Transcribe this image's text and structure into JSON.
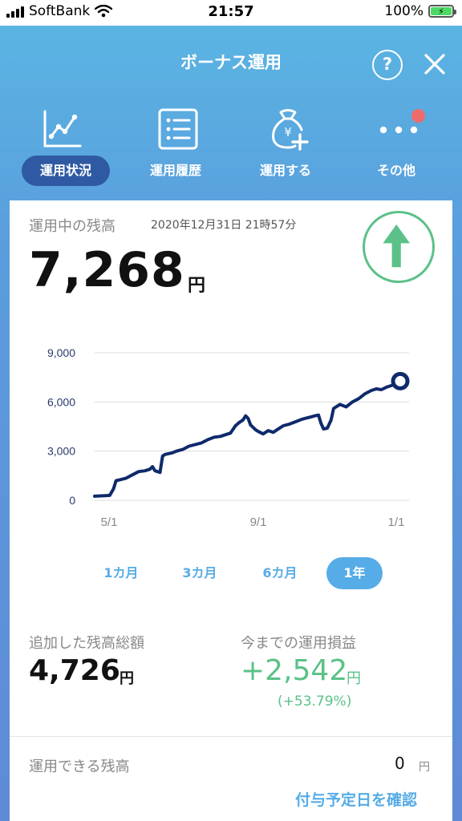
{
  "status_bar": {
    "carrier": "SoftBank",
    "time": "21:57",
    "battery_pct": "100%"
  },
  "header": {
    "title": "ボーナス運用",
    "help_label": "?"
  },
  "nav": {
    "items": [
      {
        "label": "運用状況",
        "icon": "line-chart-icon",
        "active": true
      },
      {
        "label": "運用履歴",
        "icon": "list-icon",
        "active": false
      },
      {
        "label": "運用する",
        "icon": "yen-bag-plus-icon",
        "active": false
      },
      {
        "label": "その他",
        "icon": "more-dots-icon",
        "active": false,
        "has_notification": true
      }
    ]
  },
  "balance": {
    "label": "運用中の残高",
    "date": "2020年12月31日 21時57分",
    "amount": "7,268",
    "unit": "円",
    "trend": "up"
  },
  "chart_data": {
    "type": "line",
    "y_ticks": [
      "9,000",
      "6,000",
      "3,000",
      "0"
    ],
    "x_ticks": [
      "5/1",
      "9/1",
      "1/1"
    ],
    "ylim": [
      0,
      9000
    ],
    "x_span_days": 250,
    "series": [
      {
        "points": [
          [
            0,
            250
          ],
          [
            8,
            280
          ],
          [
            12,
            300
          ],
          [
            15,
            700
          ],
          [
            17,
            1200
          ],
          [
            20,
            1250
          ],
          [
            25,
            1350
          ],
          [
            30,
            1550
          ],
          [
            35,
            1750
          ],
          [
            40,
            1800
          ],
          [
            44,
            1900
          ],
          [
            46,
            2050
          ],
          [
            48,
            1800
          ],
          [
            52,
            1700
          ],
          [
            54,
            2700
          ],
          [
            56,
            2800
          ],
          [
            62,
            2900
          ],
          [
            65,
            3000
          ],
          [
            70,
            3100
          ],
          [
            75,
            3300
          ],
          [
            80,
            3400
          ],
          [
            85,
            3500
          ],
          [
            90,
            3700
          ],
          [
            95,
            3850
          ],
          [
            100,
            3900
          ],
          [
            104,
            4000
          ],
          [
            108,
            4100
          ],
          [
            112,
            4550
          ],
          [
            115,
            4750
          ],
          [
            118,
            4900
          ],
          [
            120,
            5150
          ],
          [
            122,
            5000
          ],
          [
            124,
            4600
          ],
          [
            128,
            4300
          ],
          [
            130,
            4200
          ],
          [
            134,
            4050
          ],
          [
            138,
            4250
          ],
          [
            142,
            4150
          ],
          [
            146,
            4350
          ],
          [
            150,
            4550
          ],
          [
            155,
            4650
          ],
          [
            160,
            4800
          ],
          [
            165,
            4950
          ],
          [
            170,
            5050
          ],
          [
            175,
            5150
          ],
          [
            178,
            5200
          ],
          [
            180,
            4700
          ],
          [
            182,
            4350
          ],
          [
            185,
            4400
          ],
          [
            188,
            4900
          ],
          [
            190,
            5600
          ],
          [
            195,
            5850
          ],
          [
            200,
            5700
          ],
          [
            205,
            6000
          ],
          [
            210,
            6200
          ],
          [
            215,
            6500
          ],
          [
            220,
            6700
          ],
          [
            224,
            6800
          ],
          [
            228,
            6750
          ],
          [
            232,
            6900
          ],
          [
            236,
            7000
          ],
          [
            240,
            7150
          ],
          [
            243,
            7268
          ]
        ]
      }
    ],
    "grid": true
  },
  "periods": [
    {
      "label": "1カ月",
      "active": false
    },
    {
      "label": "3カ月",
      "active": false
    },
    {
      "label": "6カ月",
      "active": false
    },
    {
      "label": "1年",
      "active": true
    }
  ],
  "added": {
    "label": "追加した残高総額",
    "amount": "4,726",
    "unit": "円"
  },
  "profit": {
    "label": "今までの運用損益",
    "amount": "+2,542",
    "unit": "円",
    "percent": "(+53.79%)"
  },
  "available": {
    "label": "運用できる残高",
    "amount": "0",
    "unit": "円",
    "link": "付与予定日を確認"
  },
  "colors": {
    "accent_blue": "#56ace6",
    "nav_active": "#2f5aa3",
    "chart_line": "#0f2a6b",
    "profit_green": "#5bc188",
    "notification_red": "#ef6b6b"
  }
}
